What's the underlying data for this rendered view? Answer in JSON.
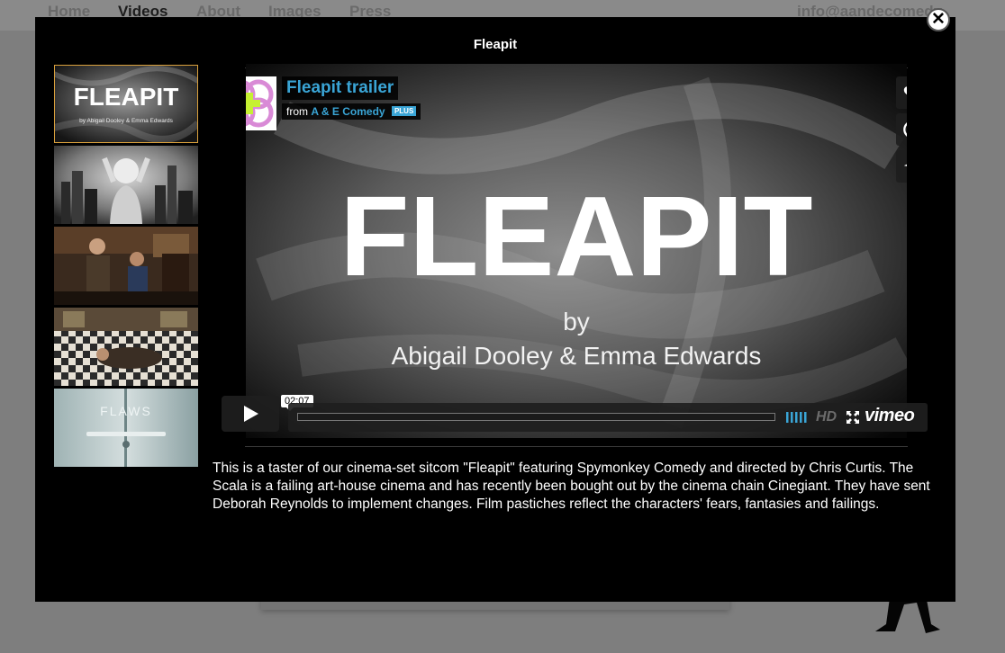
{
  "site": {
    "nav": [
      {
        "label": "Home",
        "active": false
      },
      {
        "label": "Videos",
        "active": true
      },
      {
        "label": "About",
        "active": false
      },
      {
        "label": "Images",
        "active": false
      },
      {
        "label": "Press",
        "active": false
      }
    ],
    "email": "info@aandecomedy"
  },
  "lightbox": {
    "title": "Fleapit",
    "close_label": "✕",
    "description": "This is a taster of our cinema-set sitcom \"Fleapit\" featuring Spymonkey Comedy and directed by Chris Curtis. The Scala is a failing art-house cinema and has recently been bought out by the cinema chain Cinegiant. They have sent Deborah Reynolds to implement changes. Film pastiches reflect the characters' fears, fantasies and failings.",
    "thumbnails": [
      {
        "caption": "FLEAPIT",
        "subcaption": "by Abigail Dooley & Emma Edwards",
        "selected": true
      },
      {
        "caption": "",
        "subcaption": "",
        "selected": false
      },
      {
        "caption": "",
        "subcaption": "",
        "selected": false
      },
      {
        "caption": "",
        "subcaption": "",
        "selected": false
      },
      {
        "caption": "FLAWS",
        "subcaption": "",
        "selected": false
      }
    ]
  },
  "player": {
    "video_title": "Fleapit trailer",
    "from_label": "from",
    "author": "A & E Comedy",
    "badge": "PLUS",
    "frame_title": "FLEAPIT",
    "frame_by": "by",
    "frame_credit": "Abigail Dooley & Emma Edwards",
    "timestamp": "02:07",
    "progress": 0,
    "hd_label": "HD",
    "brand": "vimeo",
    "side_buttons": [
      "heart-icon",
      "clock-icon",
      "send-icon"
    ]
  },
  "colors": {
    "accent": "#3aa5d6",
    "selected_border": "#d9a03c",
    "lightbox_bg": "#000000",
    "overlay_bg": "#7e7e7e"
  }
}
